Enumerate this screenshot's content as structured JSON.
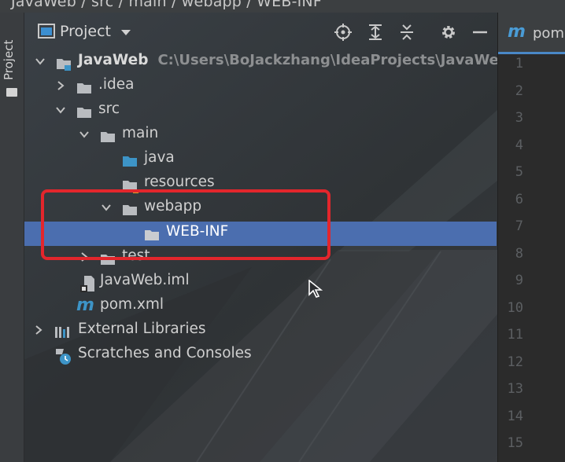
{
  "breadcrumb": {
    "text": "JavaWeb / src / main / webapp / WEB-INF"
  },
  "stripe": {
    "project_tab": "Project"
  },
  "panel": {
    "title": "Project"
  },
  "tree": {
    "root": {
      "label": "JavaWeb",
      "path": "C:\\Users\\BoJackzhang\\IdeaProjects\\JavaWeb"
    },
    "idea": {
      "label": ".idea"
    },
    "src": {
      "label": "src"
    },
    "main": {
      "label": "main"
    },
    "java": {
      "label": "java"
    },
    "resources": {
      "label": "resources"
    },
    "webapp": {
      "label": "webapp"
    },
    "webinf": {
      "label": "WEB-INF"
    },
    "test": {
      "label": "test"
    },
    "iml": {
      "label": "JavaWeb.iml"
    },
    "pom": {
      "label": "pom.xml"
    },
    "ext": {
      "label": "External Libraries"
    },
    "scratch": {
      "label": "Scratches and Consoles"
    }
  },
  "editor": {
    "tab_label": "pom",
    "tab_icon": "m",
    "line_numbers": [
      "1",
      "2",
      "3",
      "4",
      "5",
      "6",
      "7",
      "8",
      "9",
      "10",
      "11",
      "12",
      "13",
      "14",
      "15"
    ]
  },
  "colors": {
    "selection": "#4b6eaf",
    "highlight": "#e3262c",
    "folder": "#b9bcc0",
    "source_folder": "#3d94c7"
  }
}
